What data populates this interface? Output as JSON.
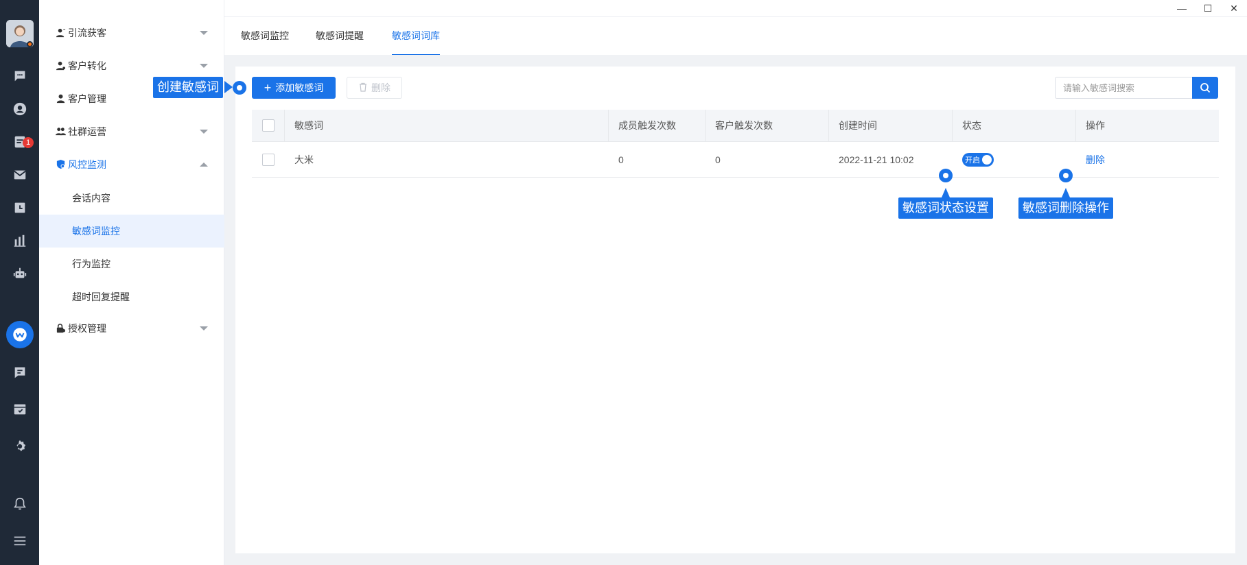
{
  "window": {
    "minimize": "—",
    "maximize": "☐",
    "close": "✕"
  },
  "rail": {
    "badge_count": "1",
    "icons": [
      "chat-icon",
      "contacts-icon",
      "tasks-icon",
      "mail-icon",
      "calendar-icon",
      "stats-icon",
      "robot-icon",
      "wecom-icon",
      "message-icon",
      "checklist-icon",
      "settings-icon",
      "bell-icon",
      "menu-icon"
    ]
  },
  "sidebar": {
    "groups": [
      {
        "label": "引流获客"
      },
      {
        "label": "客户转化"
      },
      {
        "label": "客户管理"
      },
      {
        "label": "社群运营"
      },
      {
        "label": "风控监测"
      },
      {
        "label": "授权管理"
      }
    ],
    "sub_items": [
      "会话内容",
      "敏感词监控",
      "行为监控",
      "超时回复提醒"
    ]
  },
  "tabs": [
    "敏感词监控",
    "敏感词提醒",
    "敏感词词库"
  ],
  "toolbar": {
    "add_label": "添加敏感词",
    "delete_label": "删除",
    "search_placeholder": "请输入敏感词搜索"
  },
  "table": {
    "headers": [
      "敏感词",
      "成员触发次数",
      "客户触发次数",
      "创建时间",
      "状态",
      "操作"
    ],
    "rows": [
      {
        "word": "大米",
        "member_count": "0",
        "customer_count": "0",
        "created": "2022-11-21 10:02",
        "status": "开启",
        "action": "删除"
      }
    ]
  },
  "annotations": {
    "create": "创建敏感词",
    "status": "敏感词状态设置",
    "delete": "敏感词删除操作"
  },
  "colors": {
    "accent": "#1a73e8",
    "rail": "#1f2937",
    "badge": "#e53935"
  }
}
